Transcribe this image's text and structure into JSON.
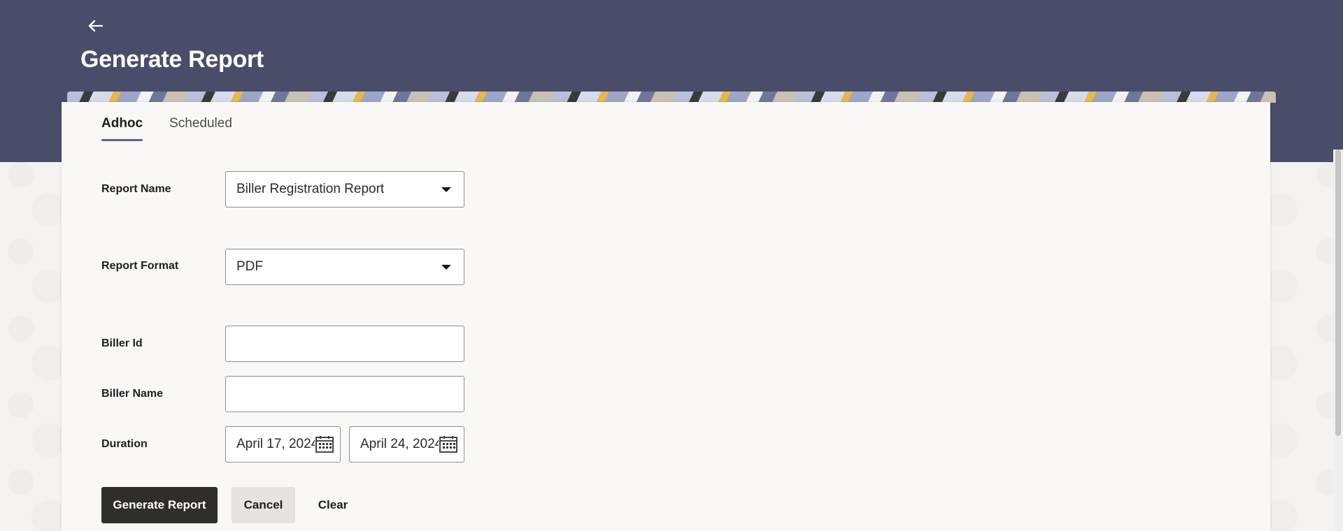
{
  "header": {
    "back_icon": "arrow-left-icon",
    "title": "Generate Report"
  },
  "tabs": [
    {
      "label": "Adhoc",
      "active": true
    },
    {
      "label": "Scheduled",
      "active": false
    }
  ],
  "form": {
    "report_name": {
      "label": "Report Name",
      "value": "Biller Registration Report"
    },
    "report_format": {
      "label": "Report Format",
      "value": "PDF"
    },
    "biller_id": {
      "label": "Biller Id",
      "value": ""
    },
    "biller_name": {
      "label": "Biller Name",
      "value": ""
    },
    "duration": {
      "label": "Duration",
      "from": "April 17, 2024",
      "to": "April 24, 2024",
      "icon": "calendar-icon"
    }
  },
  "actions": {
    "generate_label": "Generate Report",
    "cancel_label": "Cancel",
    "clear_label": "Clear"
  },
  "colors": {
    "hero": "#494d6a",
    "primary_button": "#312d2a",
    "tab_indicator": "#5d6287"
  }
}
